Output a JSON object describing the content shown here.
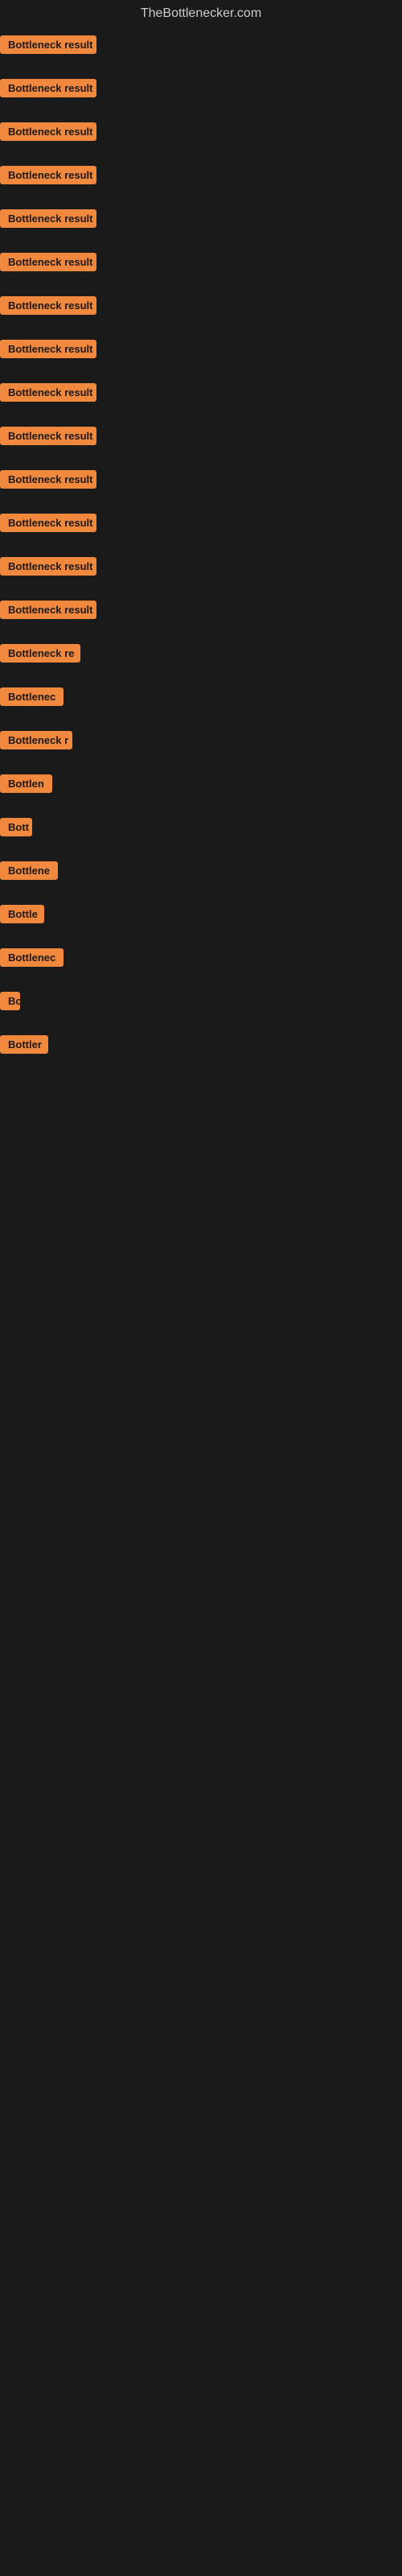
{
  "site": {
    "title": "TheBottlenecker.com"
  },
  "items": [
    {
      "id": 1,
      "label": "Bottleneck result",
      "width": "full"
    },
    {
      "id": 2,
      "label": "Bottleneck result",
      "width": "full"
    },
    {
      "id": 3,
      "label": "Bottleneck result",
      "width": "full"
    },
    {
      "id": 4,
      "label": "Bottleneck result",
      "width": "full"
    },
    {
      "id": 5,
      "label": "Bottleneck result",
      "width": "full"
    },
    {
      "id": 6,
      "label": "Bottleneck result",
      "width": "full"
    },
    {
      "id": 7,
      "label": "Bottleneck result",
      "width": "full"
    },
    {
      "id": 8,
      "label": "Bottleneck result",
      "width": "full"
    },
    {
      "id": 9,
      "label": "Bottleneck result",
      "width": "full"
    },
    {
      "id": 10,
      "label": "Bottleneck result",
      "width": "full"
    },
    {
      "id": 11,
      "label": "Bottleneck result",
      "width": "full"
    },
    {
      "id": 12,
      "label": "Bottleneck result",
      "width": "full"
    },
    {
      "id": 13,
      "label": "Bottleneck result",
      "width": "full"
    },
    {
      "id": 14,
      "label": "Bottleneck result",
      "width": "full"
    },
    {
      "id": 15,
      "label": "Bottleneck re",
      "width": "partial1"
    },
    {
      "id": 16,
      "label": "Bottlenec",
      "width": "partial2"
    },
    {
      "id": 17,
      "label": "Bottleneck r",
      "width": "partial3"
    },
    {
      "id": 18,
      "label": "Bottlen",
      "width": "partial4"
    },
    {
      "id": 19,
      "label": "Bott",
      "width": "partial5"
    },
    {
      "id": 20,
      "label": "Bottlene",
      "width": "partial6"
    },
    {
      "id": 21,
      "label": "Bottle",
      "width": "partial7"
    },
    {
      "id": 22,
      "label": "Bottlenec",
      "width": "partial8"
    },
    {
      "id": 23,
      "label": "Bo",
      "width": "partial9"
    },
    {
      "id": 24,
      "label": "Bottler",
      "width": "partial10"
    }
  ]
}
